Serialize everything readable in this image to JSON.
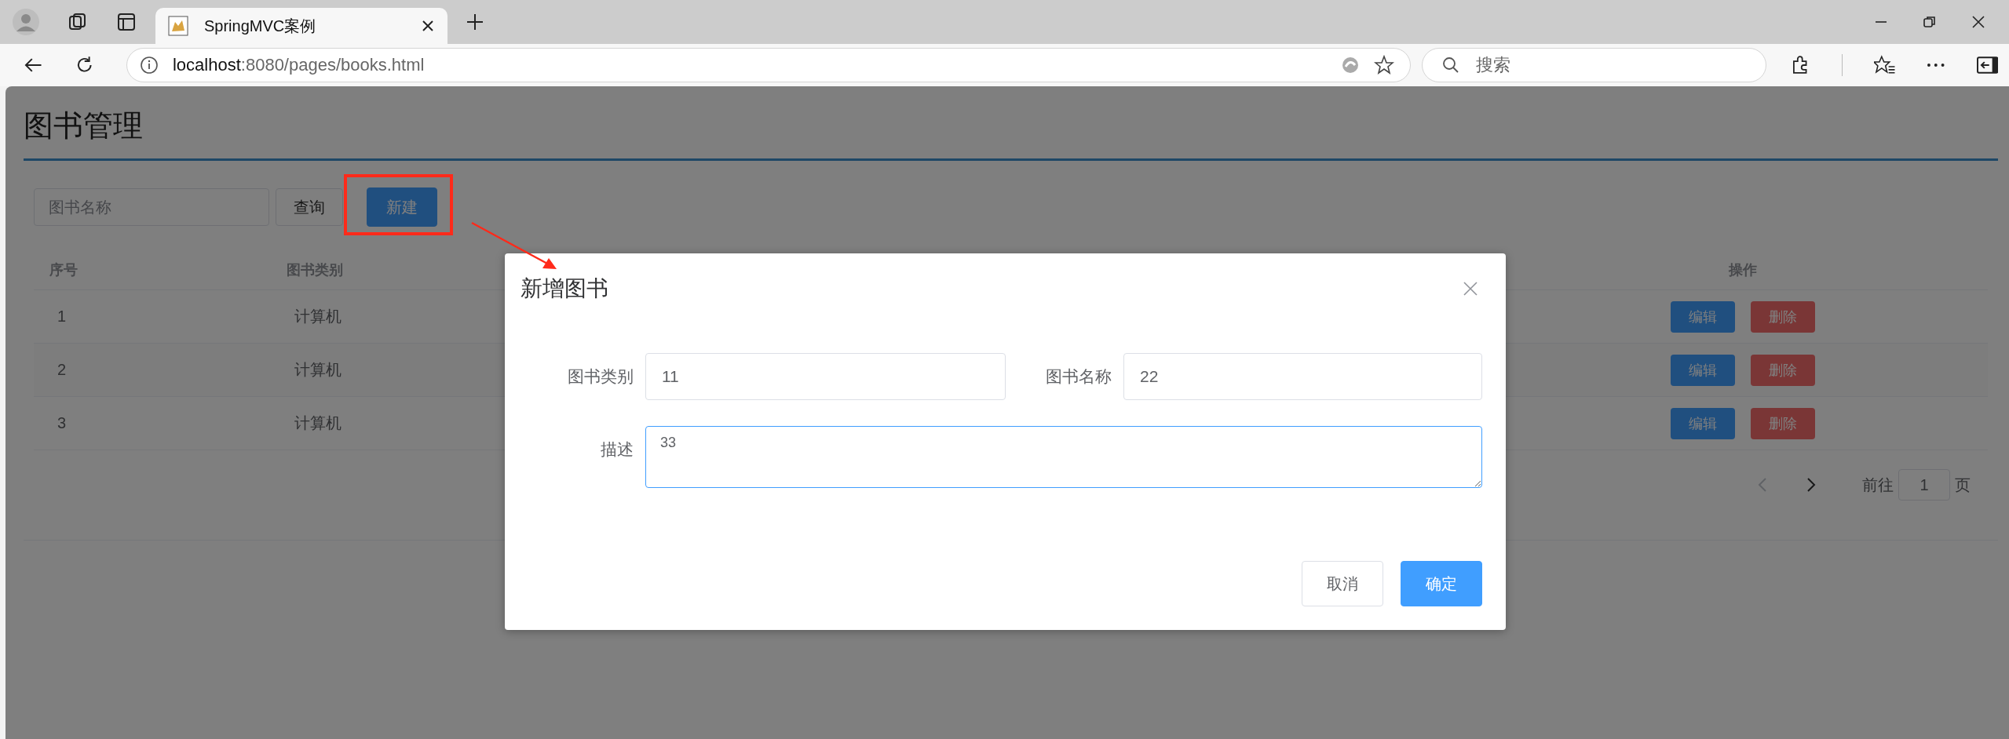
{
  "browser": {
    "tabs": [
      {
        "title": "SpringMVC案例",
        "selected": true
      }
    ],
    "address": {
      "host": "localhost",
      "rest": ":8080/pages/books.html"
    },
    "search": {
      "placeholder": "搜索"
    }
  },
  "page": {
    "title": "图书管理",
    "toolbar": {
      "search": {
        "placeholder": "图书名称"
      },
      "query_button": "查询",
      "new_button": "新建"
    },
    "table": {
      "columns": [
        "序号",
        "图书类别",
        "操作"
      ],
      "rows": [
        {
          "index": "1",
          "category": "计算机",
          "edit": "编辑",
          "delete": "删除"
        },
        {
          "index": "2",
          "category": "计算机",
          "edit": "编辑",
          "delete": "删除"
        },
        {
          "index": "3",
          "category": "计算机",
          "edit": "编辑",
          "delete": "删除"
        }
      ]
    },
    "pagination": {
      "prev_disabled": true,
      "next_disabled": false,
      "goto_label": "前往",
      "page": "1",
      "page_suffix": "页"
    }
  },
  "dialog": {
    "title": "新增图书",
    "fields": [
      {
        "label": "图书类别",
        "value": "11"
      },
      {
        "label": "图书名称",
        "value": "22"
      }
    ],
    "description": {
      "label": "描述",
      "value": "33"
    },
    "cancel_button": "取消",
    "confirm_button": "确定"
  }
}
